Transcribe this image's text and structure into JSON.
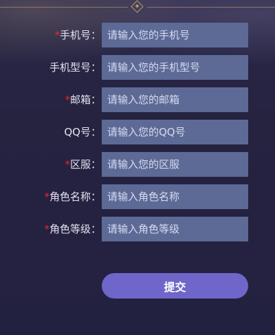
{
  "form": {
    "fields": [
      {
        "required": true,
        "label": "手机号：",
        "placeholder": "请输入您的手机号"
      },
      {
        "required": false,
        "label": "手机型号：",
        "placeholder": "请输入您的手机型号"
      },
      {
        "required": true,
        "label": "邮箱：",
        "placeholder": "请输入您的邮箱"
      },
      {
        "required": false,
        "label": "QQ号：",
        "placeholder": "请输入您的QQ号"
      },
      {
        "required": true,
        "label": "区服：",
        "placeholder": "请输入您的区服"
      },
      {
        "required": true,
        "label": "角色名称：",
        "placeholder": "请输入角色名称"
      },
      {
        "required": true,
        "label": "角色等级：",
        "placeholder": "请输入角色等级"
      }
    ],
    "required_mark": "*",
    "submit_label": "提交"
  },
  "colors": {
    "background": "#262441",
    "input_bg": "#5d6a96",
    "required": "#e8262d",
    "button": "#6f66c9",
    "frame_gold": "#b59a66"
  }
}
